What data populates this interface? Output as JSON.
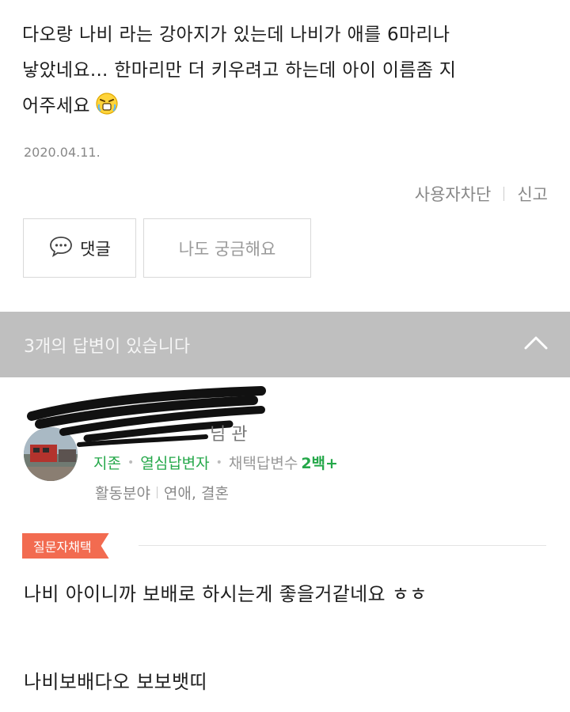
{
  "question": {
    "lines": [
      "다오랑 나비 라는 강아지가 있는데 나비가 애를 6마리나",
      "낳았네요... 한마리만 더 키우려고 하는데 아이 이름좀 지",
      "어주세요"
    ],
    "emoji": "crying-face-emoji",
    "date": "2020.04.11.",
    "block_user": "사용자차단",
    "report": "신고"
  },
  "buttons": {
    "comment": "댓글",
    "curious": "나도 궁금해요"
  },
  "answers_header": {
    "label": "3개의 답변이 있습니다",
    "toggle_icon": "chevron-up-icon"
  },
  "answerer": {
    "name_partial": "님 관",
    "rank": "지존",
    "title": "열심답변자",
    "adopted_label": "채택답변수",
    "adopted_count": "2백+",
    "field_label": "활동분야",
    "field_value": "연애, 결혼"
  },
  "answer": {
    "badge": "질문자채택",
    "line1": "나비 아이니까 보배로 하시는게 좋을거같네요 ㅎㅎ",
    "line2": "나비보배다오 보보뱃띠"
  },
  "colors": {
    "green": "#25a84a",
    "badge": "#f26b50",
    "bar": "#bfbfbf"
  }
}
